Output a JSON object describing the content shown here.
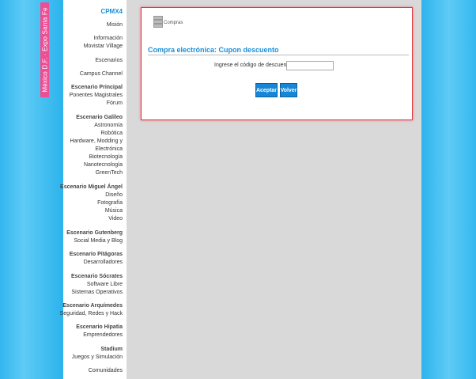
{
  "side_tab": {
    "label": "México D.F. · Expo Santa Fe"
  },
  "sidebar": {
    "logo": "CPMX4",
    "items": [
      {
        "label": "Misión"
      },
      {
        "label": "Información"
      },
      {
        "label": "Movistar Village"
      },
      {
        "label": "Escenarios"
      },
      {
        "label": "Campus Channel"
      },
      {
        "label": "Escenario Principal"
      },
      {
        "label": "Ponentes Magistrales"
      },
      {
        "label": "Fórum"
      },
      {
        "label": "Escenario Galileo"
      },
      {
        "label": "Astronomía"
      },
      {
        "label": "Robótica"
      },
      {
        "label": "Hardware, Modding y"
      },
      {
        "label": "Electrónica"
      },
      {
        "label": "Biotecnología"
      },
      {
        "label": "Nanotecnología"
      },
      {
        "label": "GreenTech"
      },
      {
        "label": "Escenario Miguel Ángel"
      },
      {
        "label": "Diseño"
      },
      {
        "label": "Fotografía"
      },
      {
        "label": "Música"
      },
      {
        "label": "Video"
      },
      {
        "label": "Escenario Gutenberg"
      },
      {
        "label": "Social Media y Blog"
      },
      {
        "label": "Escenario Pitágoras"
      },
      {
        "label": "Desarrolladores"
      },
      {
        "label": "Escenario Sócrates"
      },
      {
        "label": "Software Libre"
      },
      {
        "label": "Sistemas Operativos"
      },
      {
        "label": "Escenario Arquímedes"
      },
      {
        "label": "Seguridad, Redes y Hack"
      },
      {
        "label": "Escenario Hipatia"
      },
      {
        "label": "Emprendedores"
      },
      {
        "label": "Stadium"
      },
      {
        "label": "Juegos y Simulación"
      },
      {
        "label": "Comunidades"
      }
    ]
  },
  "breadcrumb": {
    "label": "Compras"
  },
  "form": {
    "title": "Compra electrónica: Cupon descuento",
    "code_label": "Ingrese el código de descuento:",
    "code_value": "",
    "accept_label": "Aceptar",
    "back_label": "Volver"
  }
}
